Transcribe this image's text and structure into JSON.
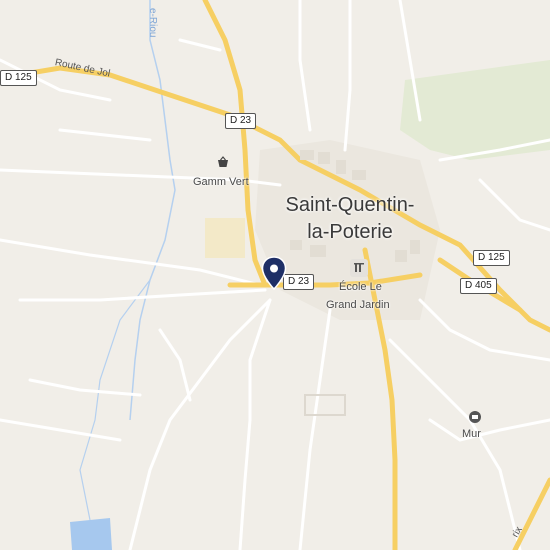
{
  "map": {
    "town": {
      "line1": "Saint-Quentin-",
      "line2": "la-Poterie"
    },
    "shields": {
      "d125_west": "D 125",
      "d23_north": "D 23",
      "d23_center": "D 23",
      "d125_east": "D 125",
      "d405": "D 405"
    },
    "road_names": {
      "route_de_jol": "Route de Jol"
    },
    "stream_names": {
      "riou": "e-Riou"
    },
    "pois": {
      "garden_center": "Gamm Vert",
      "school_line1": "École Le",
      "school_line2": "Grand Jardin",
      "mur": "Mur"
    },
    "corner_fragment": "rix",
    "icons": {
      "pin": "location-pin-icon",
      "garden_center": "shopping-basket-icon",
      "school": "school-icon",
      "mur": "landmark-icon"
    },
    "colors": {
      "land": "#f1eee8",
      "major_road": "#f6cf63",
      "minor_road": "#ffffff",
      "water": "#a6c8ee",
      "pin": "#1e2f66",
      "green": "#dfe8cd"
    }
  }
}
